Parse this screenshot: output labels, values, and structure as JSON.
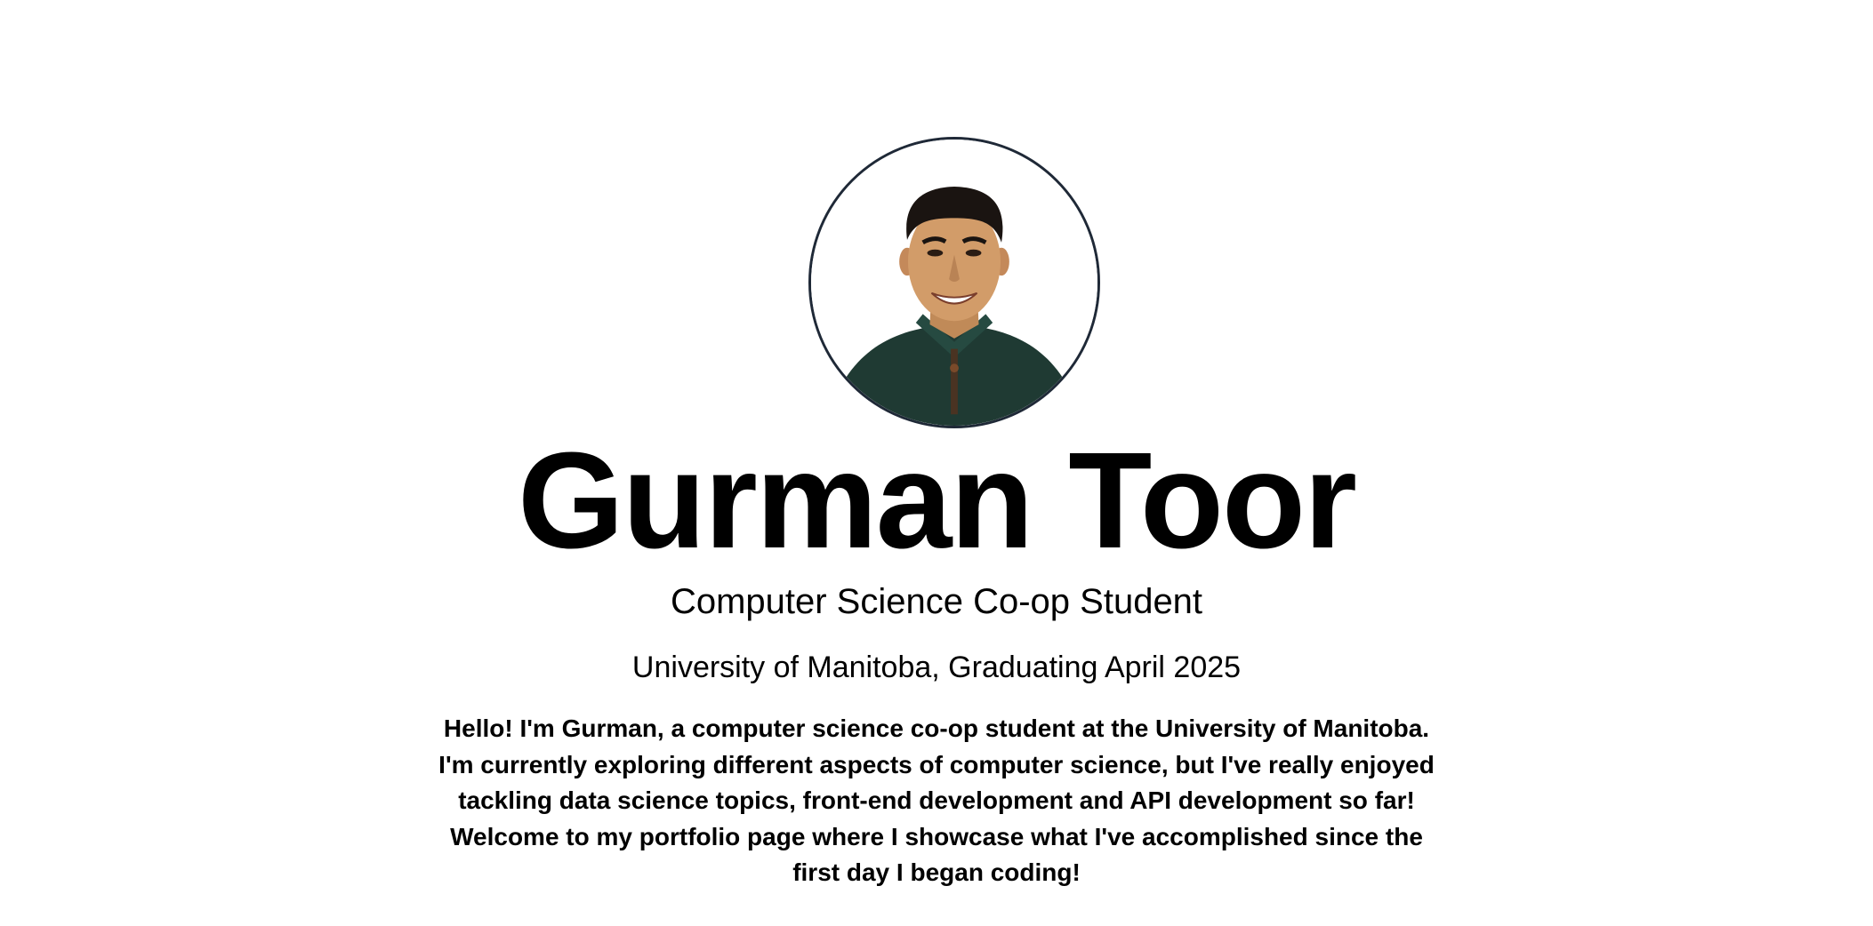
{
  "profile": {
    "name": "Gurman Toor",
    "title": "Computer Science Co-op Student",
    "school": "University of Manitoba, Graduating April 2025",
    "bio": "Hello! I'm Gurman, a computer science co-op student at the University of Manitoba. I'm currently exploring different aspects of computer science, but I've really enjoyed tackling data science topics, front-end development and API development so far! Welcome to my portfolio page where I showcase what I've accomplished since the first day I began coding!",
    "avatar_icon": "profile-photo"
  },
  "colors": {
    "background": "#ffffff",
    "text": "#000000",
    "avatar_border": "#1f2937",
    "sweater": "#1f3a33"
  }
}
